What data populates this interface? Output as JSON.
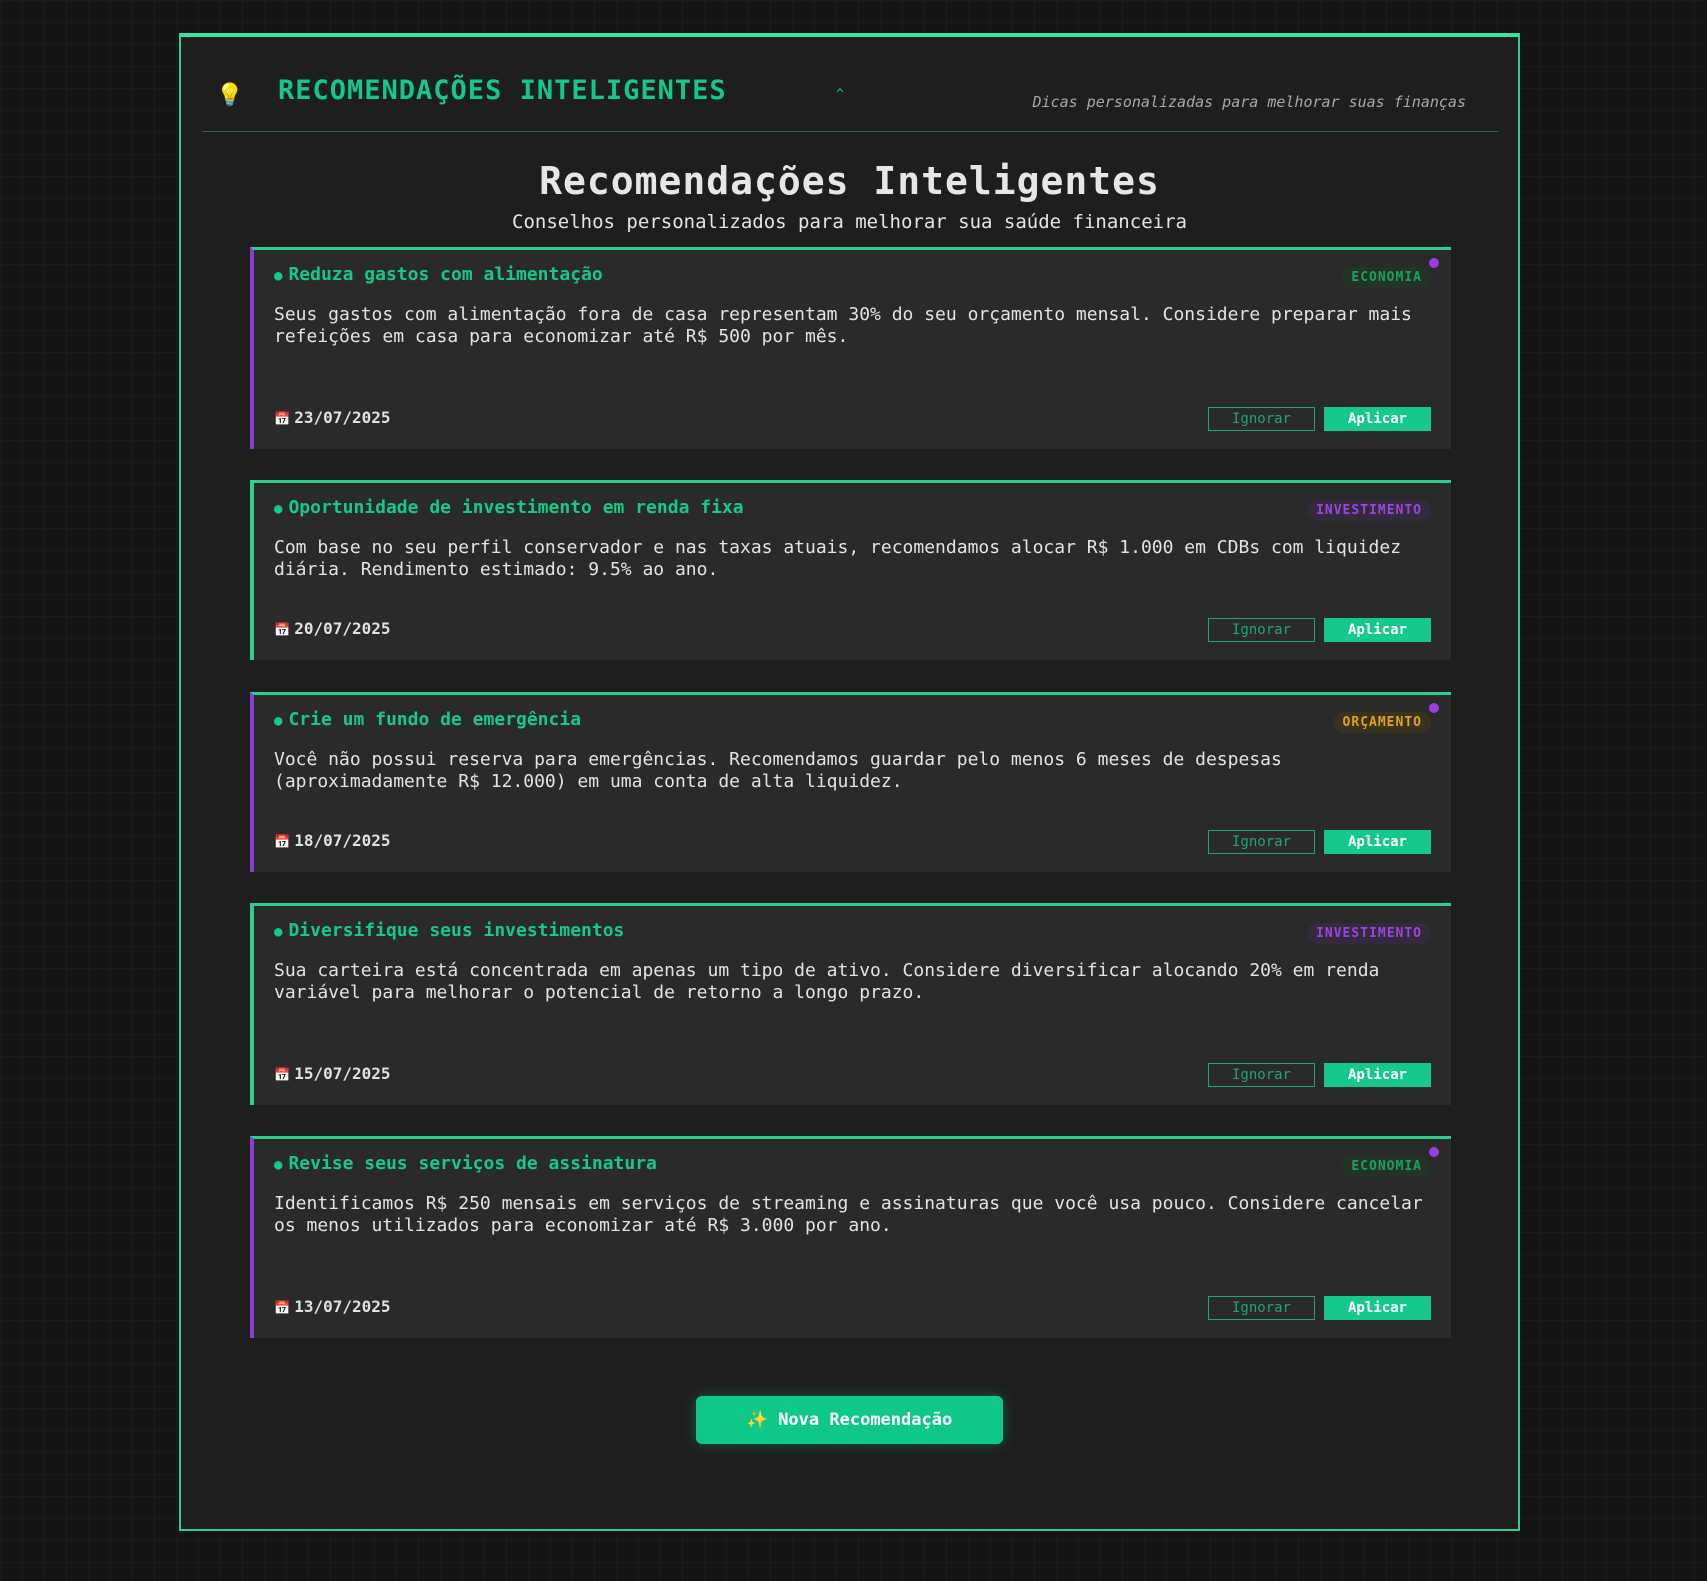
{
  "header": {
    "icon": "lightbulb-icon",
    "title": "RECOMENDAÇÕES INTELIGENTES",
    "caret": "^",
    "subtitle": "Dicas personalizadas para melhorar suas finanças"
  },
  "main": {
    "title": "Recomendações Inteligentes",
    "subtitle": "Conselhos personalizados para melhorar sua saúde financeira"
  },
  "cards": [
    {
      "title": "Reduza gastos com alimentação",
      "tag": "ECONOMIA",
      "description": "Seus gastos com alimentação fora de casa representam 30% do seu orçamento mensal. Considere preparar mais refeições em casa para economizar até R$ 500 por mês.",
      "date": "23/07/2025",
      "unread": true
    },
    {
      "title": "Oportunidade de investimento em renda fixa",
      "tag": "INVESTIMENTO",
      "description": "Com base no seu perfil conservador e nas taxas atuais, recomendamos alocar R$ 1.000 em CDBs com liquidez diária. Rendimento estimado: 9.5% ao ano.",
      "date": "20/07/2025",
      "unread": false
    },
    {
      "title": "Crie um fundo de emergência",
      "tag": "ORÇAMENTO",
      "description": "Você não possui reserva para emergências. Recomendamos guardar pelo menos 6 meses de despesas (aproximadamente R$ 12.000) em uma conta de alta liquidez.",
      "date": "18/07/2025",
      "unread": true
    },
    {
      "title": "Diversifique seus investimentos",
      "tag": "INVESTIMENTO",
      "description": "Sua carteira está concentrada em apenas um tipo de ativo. Considere diversificar alocando 20% em renda variável para melhorar o potencial de retorno a longo prazo.",
      "date": "15/07/2025",
      "unread": false
    },
    {
      "title": "Revise seus serviços de assinatura",
      "tag": "ECONOMIA",
      "description": "Identificamos R$ 250 mensais em serviços de streaming e assinaturas que você usa pouco. Considere cancelar os menos utilizados para economizar até R$ 3.000 por ano.",
      "date": "13/07/2025",
      "unread": true
    }
  ],
  "buttons": {
    "ignore": "Ignorar",
    "apply": "Aplicar",
    "new": "✨ Nova Recomendação"
  },
  "colors": {
    "accent": "#10c98a",
    "unread": "#8a3fd1",
    "economia": "#17a35a",
    "investimento": "#9f45df",
    "orcamento": "#e3a416"
  }
}
